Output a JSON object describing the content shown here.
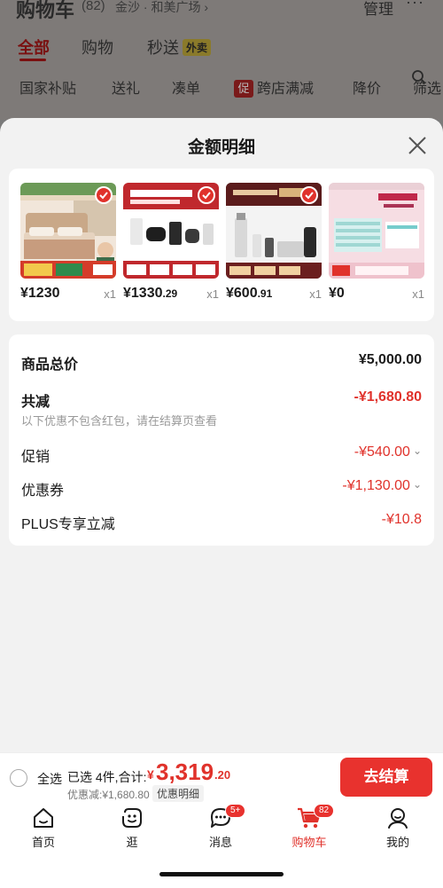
{
  "background": {
    "title": "购物车",
    "count": "(82)",
    "location": "金沙 · 和美广场 ›",
    "manage": "管理",
    "more": "···",
    "tabs": [
      "全部",
      "购物",
      "秒送"
    ],
    "waimai_badge": "外卖",
    "chips": [
      "国家补贴",
      "送礼",
      "凑单",
      "跨店满减",
      "降价",
      "筛选"
    ],
    "cu_badge": "促"
  },
  "sheet": {
    "title": "金额明细",
    "products": [
      {
        "price": "¥1230",
        "cents": "",
        "qty": "x1"
      },
      {
        "price": "¥1330",
        "cents": ".29",
        "qty": "x1"
      },
      {
        "price": "¥600",
        "cents": ".91",
        "qty": "x1"
      },
      {
        "price": "¥0",
        "cents": "",
        "qty": "x1"
      }
    ],
    "summary": {
      "total_label": "商品总价",
      "total_value": "¥5,000.00",
      "reduce_label": "共减",
      "reduce_value": "-¥1,680.80",
      "reduce_note": "以下优惠不包含红包，请在结算页查看",
      "promo_label": "促销",
      "promo_value": "-¥540.00",
      "coupon_label": "优惠券",
      "coupon_value": "-¥1,130.00",
      "plus_label": "PLUS专享立减",
      "plus_value": "-¥10.8"
    }
  },
  "checkout": {
    "select_all": "全选",
    "selected_info": "已选 4件,合计:",
    "yen": "¥",
    "total_main": "3,319",
    "total_cents": ".20",
    "discount_text": "优惠减:¥1,680.80",
    "detail_link": "优惠明细",
    "button": "去结算"
  },
  "tabbar": {
    "items": [
      {
        "label": "首页",
        "icon": "home-icon"
      },
      {
        "label": "逛",
        "icon": "browse-face-icon"
      },
      {
        "label": "消息",
        "icon": "message-icon",
        "badge": "5+"
      },
      {
        "label": "购物车",
        "icon": "cart-icon",
        "badge": "82"
      },
      {
        "label": "我的",
        "icon": "profile-icon"
      }
    ]
  },
  "colors": {
    "accent": "#e0322b",
    "sheet_bg": "#f2f2f2",
    "dim_bg": "#7e7a78"
  }
}
